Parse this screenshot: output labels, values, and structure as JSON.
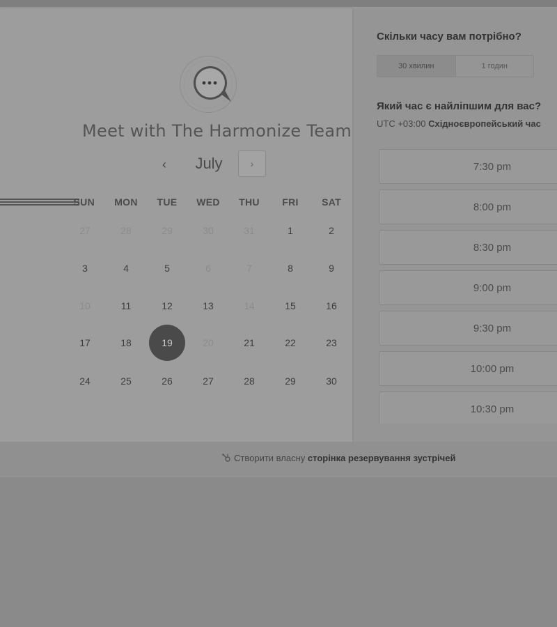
{
  "meeting": {
    "title": "Meet with The Harmonize Team"
  },
  "calendar": {
    "month": "July",
    "prev_label": "‹",
    "next_label": "›",
    "weekdays": [
      "SUN",
      "MON",
      "TUE",
      "WED",
      "THU",
      "FRI",
      "SAT"
    ],
    "weeks": [
      [
        {
          "d": "27",
          "m": true
        },
        {
          "d": "28",
          "m": true
        },
        {
          "d": "29",
          "m": true
        },
        {
          "d": "30",
          "m": true
        },
        {
          "d": "31",
          "m": true
        },
        {
          "d": "1",
          "m": false
        },
        {
          "d": "2",
          "m": false
        }
      ],
      [
        {
          "d": "3",
          "m": false
        },
        {
          "d": "4",
          "m": false
        },
        {
          "d": "5",
          "m": false
        },
        {
          "d": "6",
          "m": true
        },
        {
          "d": "7",
          "m": true
        },
        {
          "d": "8",
          "m": false
        },
        {
          "d": "9",
          "m": false
        }
      ],
      [
        {
          "d": "10",
          "m": true
        },
        {
          "d": "11",
          "m": false
        },
        {
          "d": "12",
          "m": false
        },
        {
          "d": "13",
          "m": false
        },
        {
          "d": "14",
          "m": true
        },
        {
          "d": "15",
          "m": false
        },
        {
          "d": "16",
          "m": false
        }
      ],
      [
        {
          "d": "17",
          "m": false
        },
        {
          "d": "18",
          "m": false
        },
        {
          "d": "19",
          "m": false,
          "selected": true
        },
        {
          "d": "20",
          "m": true
        },
        {
          "d": "21",
          "m": false
        },
        {
          "d": "22",
          "m": false
        },
        {
          "d": "23",
          "m": false
        }
      ],
      [
        {
          "d": "24",
          "m": false
        },
        {
          "d": "25",
          "m": false
        },
        {
          "d": "26",
          "m": false
        },
        {
          "d": "27",
          "m": false
        },
        {
          "d": "28",
          "m": false
        },
        {
          "d": "29",
          "m": false
        },
        {
          "d": "30",
          "m": false
        }
      ]
    ]
  },
  "duration": {
    "question": "Скільки часу вам потрібно?",
    "options": [
      "30 хвилин",
      "1 годин"
    ],
    "selected": "30 хвилин"
  },
  "time": {
    "question": "Який час є найліпшим для вас?",
    "timezone_offset": "UTC +03:00",
    "timezone_name": "Східноєвропейський час",
    "slots": [
      "7:30 pm",
      "8:00 pm",
      "8:30 pm",
      "9:00 pm",
      "9:30 pm",
      "10:00 pm",
      "10:30 pm"
    ]
  },
  "footer": {
    "prefix": "Створити власну",
    "link": "сторінка резервування зустрічей"
  },
  "icons": {
    "avatar": "chat-bubble-icon",
    "prev": "chevron-left-icon",
    "next": "chevron-right-icon",
    "footer": "sprocket-icon"
  },
  "colors": {
    "selected_day": "#4a4a4a"
  }
}
